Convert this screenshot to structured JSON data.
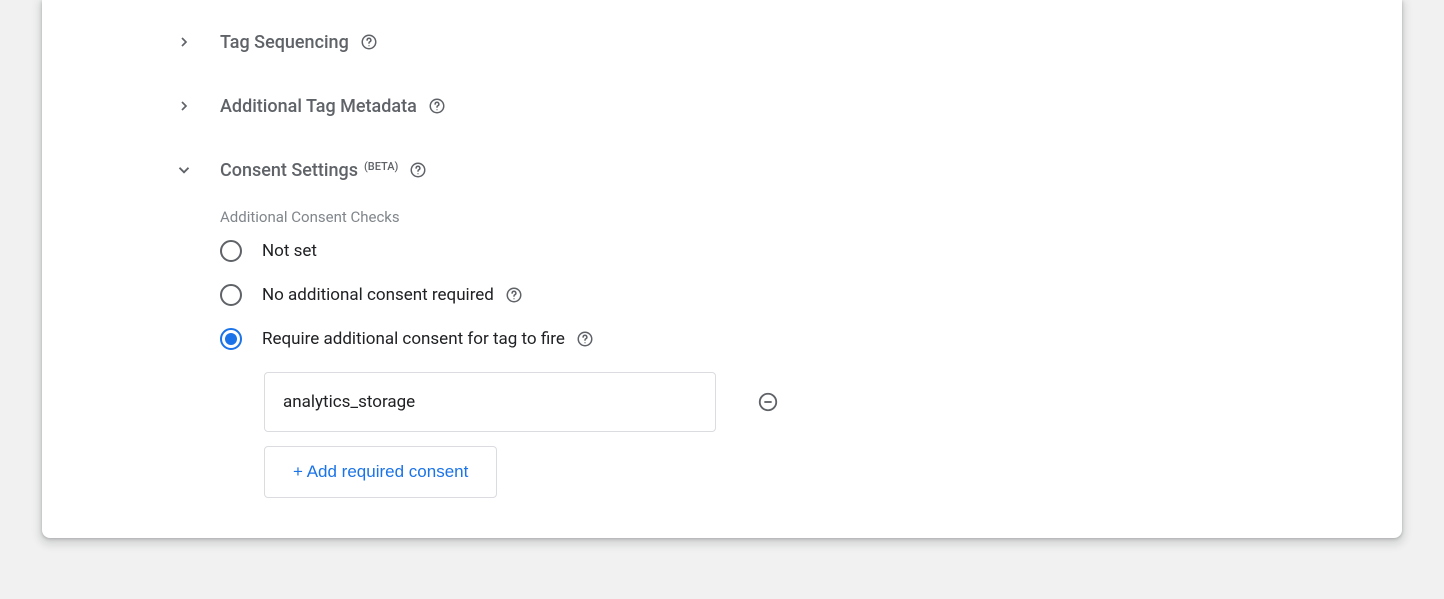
{
  "sections": {
    "tag_sequencing": {
      "title": "Tag Sequencing"
    },
    "additional_metadata": {
      "title": "Additional Tag Metadata"
    },
    "consent_settings": {
      "title": "Consent Settings",
      "beta_label": "(BETA)",
      "subheader": "Additional Consent Checks",
      "options": {
        "not_set": "Not set",
        "no_additional": "No additional consent required",
        "require_additional": "Require additional consent for tag to fire"
      },
      "consent_value": "analytics_storage",
      "add_button": "+ Add required consent"
    }
  }
}
